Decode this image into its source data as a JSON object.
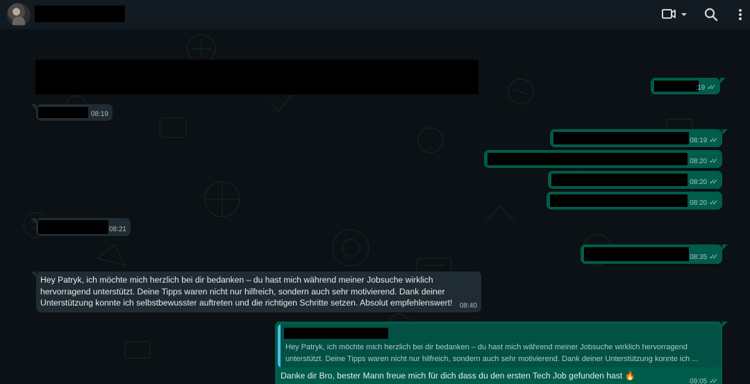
{
  "header": {
    "icons": [
      "video-call-icon",
      "chevron-down-icon",
      "search-icon",
      "more-vert-icon"
    ]
  },
  "messages": [
    {
      "dir": "out",
      "time": ":19"
    },
    {
      "dir": "in",
      "time": "08:19"
    },
    {
      "dir": "out",
      "time": "08:19"
    },
    {
      "dir": "out",
      "time": "08:20"
    },
    {
      "dir": "out",
      "time": "08:20"
    },
    {
      "dir": "out",
      "time": "08:20"
    },
    {
      "dir": "in",
      "time": "08:21"
    },
    {
      "dir": "out",
      "time": "08:35"
    },
    {
      "dir": "in",
      "time": "08:40",
      "text_line1": "Hey Patryk, ich möchte mich herzlich bei dir bedanken – du hast mich während meiner Jobsuche wirklich",
      "text_line2": "hervorragend unterstützt. Deine Tipps waren nicht nur hilfreich, sondern auch sehr motivierend. Dank deiner",
      "text_line3": "Unterstützung konnte ich selbstbewusster auftreten und die richtigen Schritte setzen. Absolut empfehlenswert!"
    },
    {
      "dir": "out",
      "time": "09:05",
      "quote_line1": "Hey Patryk, ich möchte mich herzlich bei dir bedanken – du hast mich während meiner Jobsuche wirklich hervorragend",
      "quote_line2": "unterstützt. Deine Tipps waren nicht nur hilfreich, sondern auch sehr motivierend. Dank deiner Unterstützung konnte ich ...",
      "text": "Danke dir Bro, bester Mann freue mich für dich dass du den ersten Tech Job gefunden hast",
      "emoji": "🔥"
    }
  ],
  "colors": {
    "header_bg": "#111b21",
    "chat_bg": "#0b1114",
    "incoming_bubble": "#202c33",
    "outgoing_bubble": "#005c4b",
    "quote_bar": "#53bdeb"
  }
}
